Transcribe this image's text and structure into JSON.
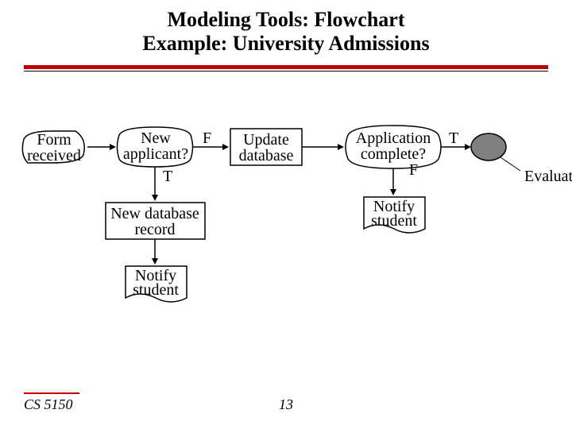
{
  "title_line1": "Modeling Tools: Flowchart",
  "title_line2": "Example: University Admissions",
  "footer_course": "CS 5150",
  "footer_page": "13",
  "nodes": {
    "form_received_l1": "Form",
    "form_received_l2": "received",
    "new_applicant_l1": "New",
    "new_applicant_l2": "applicant?",
    "update_db_l1": "Update",
    "update_db_l2": "database",
    "application_complete_l1": "Application",
    "application_complete_l2": "complete?",
    "evaluate": "Evaluate",
    "new_db_record_l1": "New database",
    "new_db_record_l2": "record",
    "notify_student_1_l1": "Notify",
    "notify_student_1_l2": "student",
    "notify_student_2_l1": "Notify",
    "notify_student_2_l2": "student"
  },
  "labels": {
    "T": "T",
    "F": "F"
  }
}
